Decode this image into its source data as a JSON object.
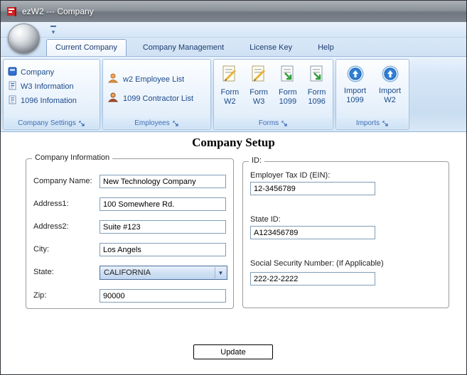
{
  "window": {
    "title": "ezW2 --- Company"
  },
  "ribbon": {
    "tabs": [
      {
        "label": "Current Company",
        "active": true
      },
      {
        "label": "Company Management",
        "active": false
      },
      {
        "label": "License Key",
        "active": false
      },
      {
        "label": "Help",
        "active": false
      }
    ],
    "groups": [
      {
        "label": "Company Settings",
        "items": [
          "Company",
          "W3 Information",
          "1096 Infomation"
        ]
      },
      {
        "label": "Employees",
        "items": [
          "w2 Employee List",
          "1099 Contractor List"
        ]
      },
      {
        "label": "Forms",
        "items": [
          "Form W2",
          "Form W3",
          "Form 1099",
          "Form 1096"
        ]
      },
      {
        "label": "Imports",
        "items": [
          "Import 1099",
          "Import W2"
        ]
      }
    ]
  },
  "main": {
    "title": "Company Setup",
    "company_info": {
      "legend": "Company Information",
      "fields": [
        {
          "label": "Company Name:",
          "value": "New Technology Company"
        },
        {
          "label": "Address1:",
          "value": "100 Somewhere Rd."
        },
        {
          "label": "Address2:",
          "value": "Suite #123"
        },
        {
          "label": "City:",
          "value": "Los Angels"
        },
        {
          "label": "State:",
          "value": "CALIFORNIA"
        },
        {
          "label": "Zip:",
          "value": "90000"
        }
      ]
    },
    "id_section": {
      "legend": "ID:",
      "fields": [
        {
          "label": "Employer Tax ID (EIN):",
          "value": "12-3456789"
        },
        {
          "label": "State ID:",
          "value": "A123456789"
        },
        {
          "label": "Social Security Number: (If Applicable)",
          "value": "222-22-2222"
        }
      ]
    },
    "update_label": "Update"
  },
  "icons": {
    "app": "red ez flag logo",
    "dropdown_arrow": "▾",
    "company": "blue square",
    "w3_info": "document with blue lines",
    "info_1096": "document with blue lines",
    "employee": "orange person",
    "contractor": "red-brown person",
    "form_edit": "page with yellow pencil",
    "form_arrow": "page with green arrow",
    "import": "blue circle with up arrow",
    "dialog_launcher": "corner with arrow"
  },
  "colors": {
    "accent_blue": "#1b4a8a",
    "group_label_blue": "#3e6db5",
    "ribbon_bg": "#d3e4f5",
    "titlebar_gray": "#7e858d",
    "input_border": "#7f9db9"
  }
}
